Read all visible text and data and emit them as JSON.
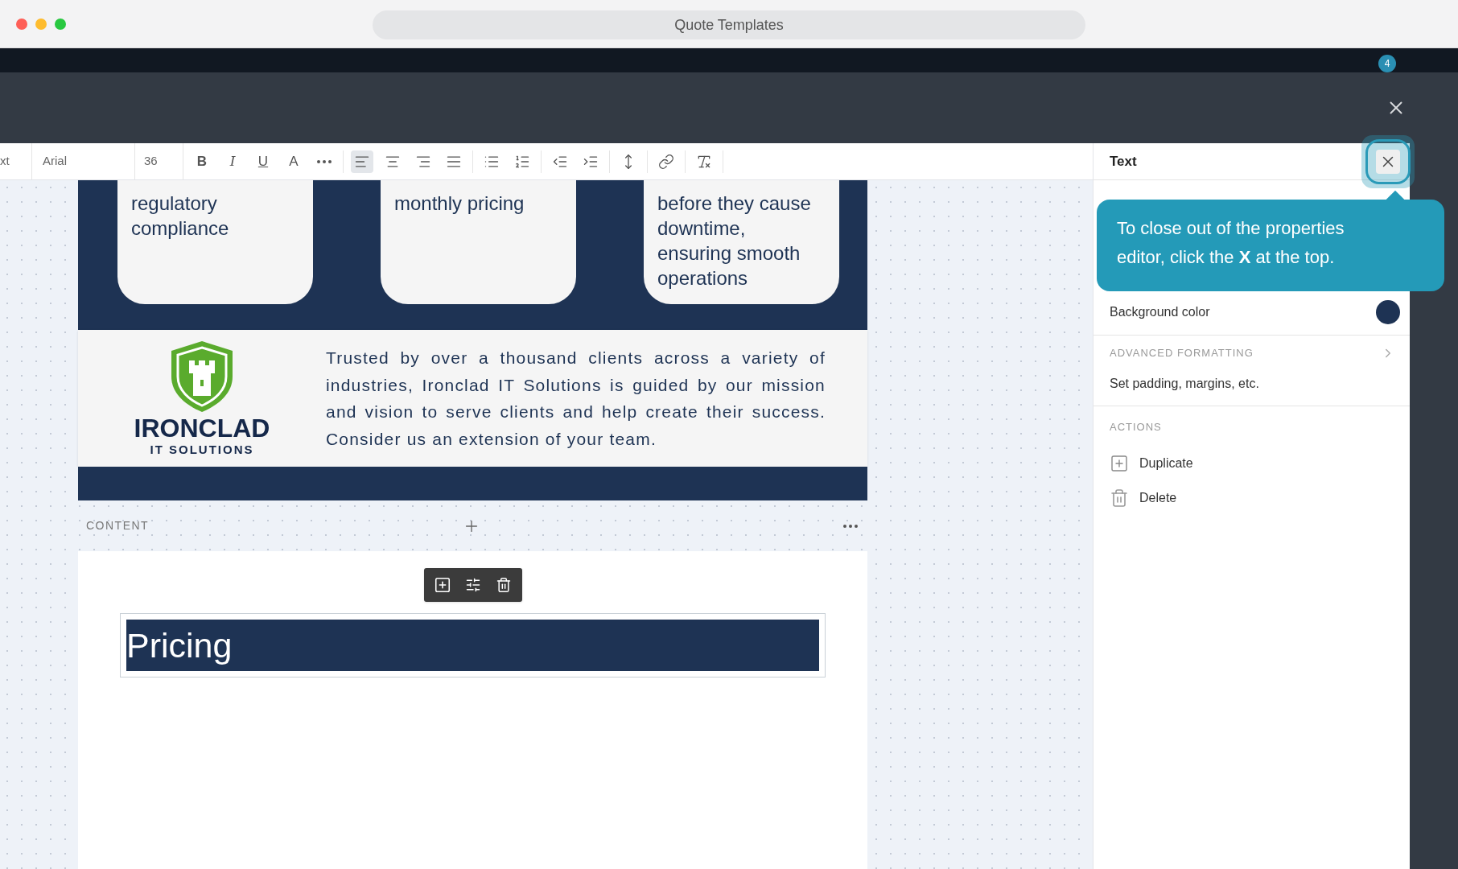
{
  "window": {
    "title": "Quote Templates"
  },
  "app_header": {
    "badge": "4"
  },
  "toolbar": {
    "style_field": "xt",
    "font": "Arial",
    "size": "36",
    "groups": [
      [
        {
          "kind": "bold",
          "label": "B",
          "selected": false
        },
        {
          "kind": "italic",
          "label": "I",
          "selected": false
        },
        {
          "kind": "underline",
          "label": "U",
          "selected": false
        },
        {
          "kind": "color",
          "label": "A",
          "selected": false
        },
        {
          "kind": "more",
          "selected": false
        }
      ],
      [
        {
          "kind": "align-left",
          "selected": true
        },
        {
          "kind": "align-center",
          "selected": false
        },
        {
          "kind": "align-right",
          "selected": false
        },
        {
          "kind": "align-justify",
          "selected": false
        }
      ],
      [
        {
          "kind": "bullets",
          "selected": false
        },
        {
          "kind": "numbers",
          "selected": false
        }
      ],
      [
        {
          "kind": "outdent",
          "selected": false
        },
        {
          "kind": "indent",
          "selected": false
        }
      ],
      [
        {
          "kind": "line-height",
          "selected": false
        }
      ],
      [
        {
          "kind": "link",
          "selected": false
        }
      ],
      [
        {
          "kind": "clear",
          "selected": false
        }
      ]
    ]
  },
  "document": {
    "cards": [
      {
        "lines": [
          "regulatory",
          "compliance"
        ]
      },
      {
        "lines": [
          "monthly pricing"
        ]
      },
      {
        "lines": [
          "before they cause",
          "downtime,",
          "ensuring smooth",
          "operations"
        ]
      }
    ],
    "logo": {
      "name": "IRONCLAD",
      "tagline": "IT SOLUTIONS"
    },
    "about": "Trusted by over a thousand clients across a variety of industries, Ironclad IT Solutions is guided by our mission and vision to serve clients and help create their success. Consider us an extension of your team.",
    "section": {
      "label": "CONTENT"
    },
    "heading": "Pricing"
  },
  "panel": {
    "title": "Text",
    "background": {
      "label": "Background color",
      "color": "#1e3354"
    },
    "advanced": {
      "title": "ADVANCED FORMATTING",
      "subtitle": "Set padding, margins, etc."
    },
    "actions_title": "ACTIONS",
    "actions": [
      {
        "kind": "duplicate",
        "label": "Duplicate"
      },
      {
        "kind": "delete",
        "label": "Delete"
      }
    ]
  },
  "tooltip": {
    "text": "To close out of the properties editor, click the **X** at the top."
  }
}
